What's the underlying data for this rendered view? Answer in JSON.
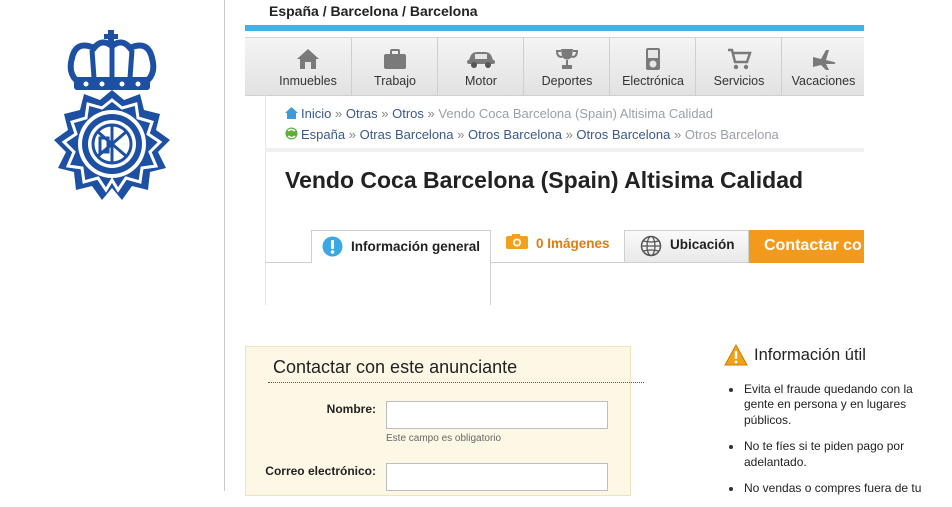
{
  "location": "España / Barcelona / Barcelona",
  "categories": [
    {
      "label": "Inmuebles",
      "icon": "house-icon"
    },
    {
      "label": "Trabajo",
      "icon": "briefcase-icon"
    },
    {
      "label": "Motor",
      "icon": "car-icon"
    },
    {
      "label": "Deportes",
      "icon": "trophy-icon"
    },
    {
      "label": "Electrónica",
      "icon": "device-icon"
    },
    {
      "label": "Servicios",
      "icon": "cart-icon"
    },
    {
      "label": "Vacaciones",
      "icon": "plane-icon"
    }
  ],
  "breadcrumb1": {
    "items": [
      "Inicio",
      "Otras",
      "Otros"
    ],
    "current": "Vendo Coca Barcelona (Spain) Altisima Calidad",
    "separator": "»"
  },
  "breadcrumb2": {
    "items": [
      "España",
      "Otras Barcelona",
      "Otros Barcelona",
      "Otros Barcelona"
    ],
    "current": "Otros Barcelona",
    "separator": "»"
  },
  "ad_title": "Vendo Coca Barcelona (Spain) Altisima Calidad",
  "tabs": {
    "info": "Información general",
    "images": "0 Imágenes",
    "location": "Ubicación",
    "contact": "Contactar co"
  },
  "contact_form": {
    "title": "Contactar con este anunciante",
    "name_label": "Nombre:",
    "name_hint": "Este campo es obligatorio",
    "email_label": "Correo electrónico:",
    "name_value": "",
    "email_value": ""
  },
  "info_util": {
    "title": "Información útil",
    "tips": [
      [
        "Evita el fraude quedando con la",
        "gente en persona y en lugares",
        "públicos."
      ],
      [
        "No te fíes si te piden pago por",
        "adelantado."
      ],
      [
        "No vendas o compres fuera de tu"
      ]
    ]
  },
  "colors": {
    "accent_blue": "#3fb2e6",
    "emblem_blue": "#1d50a2",
    "contact_orange": "#f39a1c",
    "image_tab_orange": "#e07b12",
    "warning_orange": "#f2a21a"
  }
}
